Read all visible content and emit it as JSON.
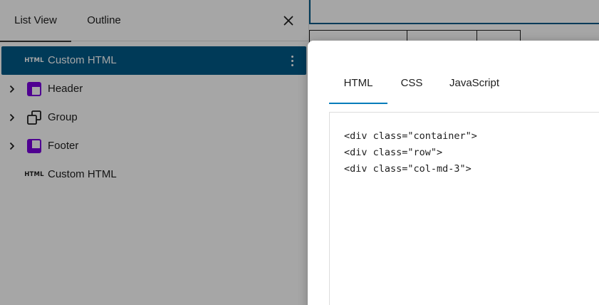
{
  "sidebar": {
    "tabs": [
      {
        "label": "List View",
        "active": true
      },
      {
        "label": "Outline",
        "active": false
      }
    ],
    "close_icon": "close-icon",
    "items": [
      {
        "label": "Custom HTML",
        "icon": "html-block-icon",
        "icon_text": "HTML",
        "selected": true,
        "has_chevron": false
      },
      {
        "label": "Header",
        "icon": "template-part-header-icon",
        "icon_color": "#7a00df",
        "selected": false,
        "has_chevron": true
      },
      {
        "label": "Group",
        "icon": "group-icon",
        "selected": false,
        "has_chevron": true
      },
      {
        "label": "Footer",
        "icon": "template-part-footer-icon",
        "icon_color": "#7a00df",
        "selected": false,
        "has_chevron": true
      },
      {
        "label": "Custom HTML",
        "icon": "html-block-icon",
        "icon_text": "HTML",
        "selected": false,
        "has_chevron": false
      }
    ]
  },
  "modal": {
    "tabs": [
      {
        "label": "HTML",
        "active": true
      },
      {
        "label": "CSS",
        "active": false
      },
      {
        "label": "JavaScript",
        "active": false
      }
    ],
    "code_lines": [
      "<div class=\"container\">",
      "<div class=\"row\">",
      "<div class=\"col-md-3\">"
    ]
  },
  "colors": {
    "selected_bg": "#005a87",
    "accent": "#007cba",
    "template_part": "#7a00df",
    "overlay": "rgba(0,0,0,0.35)"
  }
}
